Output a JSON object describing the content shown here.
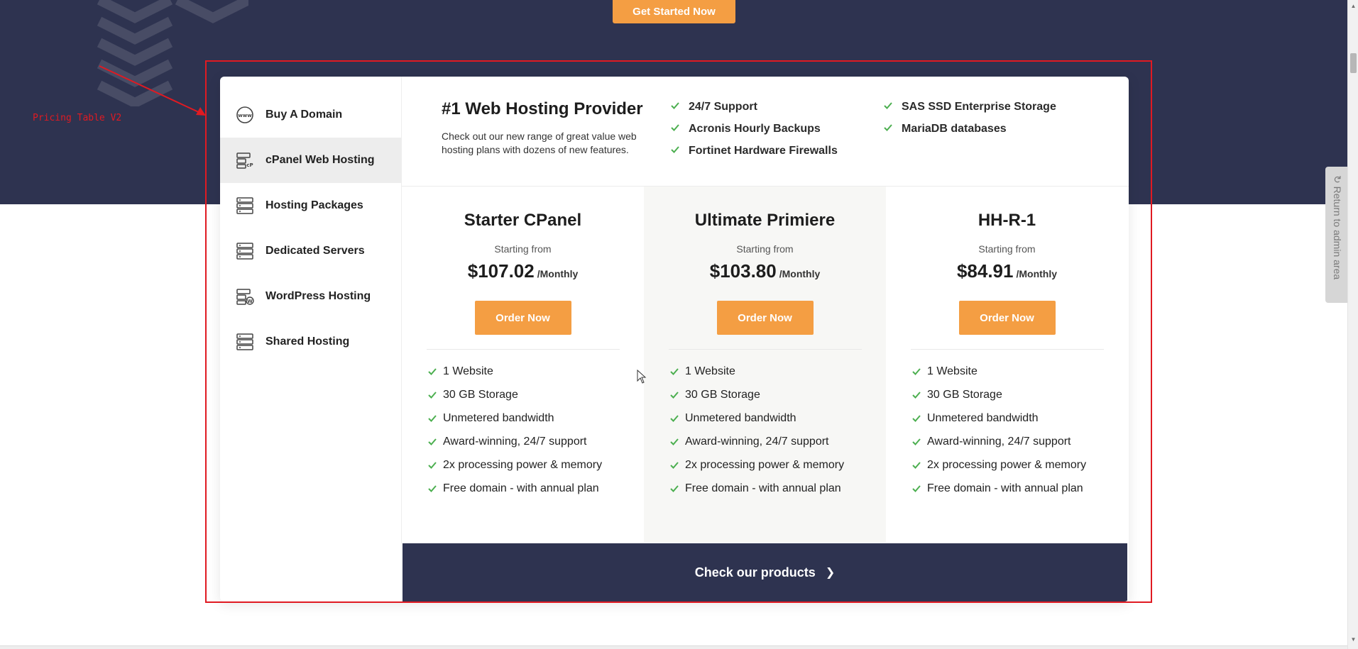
{
  "hero_button": {
    "label": "Get Started Now"
  },
  "annotation": {
    "label": "Pricing Table V2",
    "color": "#e01a22"
  },
  "colors": {
    "navy": "#2e3350",
    "accent": "#f49e43",
    "check": "#4caf50"
  },
  "sidebar": {
    "items": [
      {
        "label": "Buy A Domain",
        "icon": "www-globe-icon",
        "active": false
      },
      {
        "label": "cPanel Web Hosting",
        "icon": "cpanel-server-icon",
        "active": true
      },
      {
        "label": "Hosting Packages",
        "icon": "server-stack-icon",
        "active": false
      },
      {
        "label": "Dedicated Servers",
        "icon": "server-stack-icon",
        "active": false
      },
      {
        "label": "WordPress Hosting",
        "icon": "wordpress-server-icon",
        "active": false
      },
      {
        "label": "Shared Hosting",
        "icon": "server-stack-icon",
        "active": false
      }
    ]
  },
  "hero": {
    "title": "#1 Web Hosting Provider",
    "description": "Check out our new range of great value web hosting plans with dozens of new features.",
    "features_col1": [
      "24/7 Support",
      "Acronis Hourly Backups",
      "Fortinet Hardware Firewalls"
    ],
    "features_col2": [
      "SAS SSD Enterprise Storage",
      "MariaDB databases"
    ]
  },
  "plans": [
    {
      "name": "Starter CPanel",
      "starting": "Starting from",
      "price": "$107.02",
      "period": "/Monthly",
      "button": "Order Now",
      "features": [
        "1 Website",
        "30 GB Storage",
        "Unmetered bandwidth",
        "Award-winning, 24/7 support",
        "2x processing power & memory",
        "Free domain - with annual plan"
      ]
    },
    {
      "name": "Ultimate Primiere",
      "starting": "Starting from",
      "price": "$103.80",
      "period": "/Monthly",
      "button": "Order Now",
      "features": [
        "1 Website",
        "30 GB Storage",
        "Unmetered bandwidth",
        "Award-winning, 24/7 support",
        "2x processing power & memory",
        "Free domain - with annual plan"
      ]
    },
    {
      "name": "HH-R-1",
      "starting": "Starting from",
      "price": "$84.91",
      "period": "/Monthly",
      "button": "Order Now",
      "features": [
        "1 Website",
        "30 GB Storage",
        "Unmetered bandwidth",
        "Award-winning, 24/7 support",
        "2x processing power & memory",
        "Free domain - with annual plan"
      ]
    }
  ],
  "footer": {
    "label": "Check our products",
    "icon": "chevron-right-icon"
  },
  "admin_tab": {
    "label": "Return to admin area",
    "icon": "refresh-icon"
  }
}
